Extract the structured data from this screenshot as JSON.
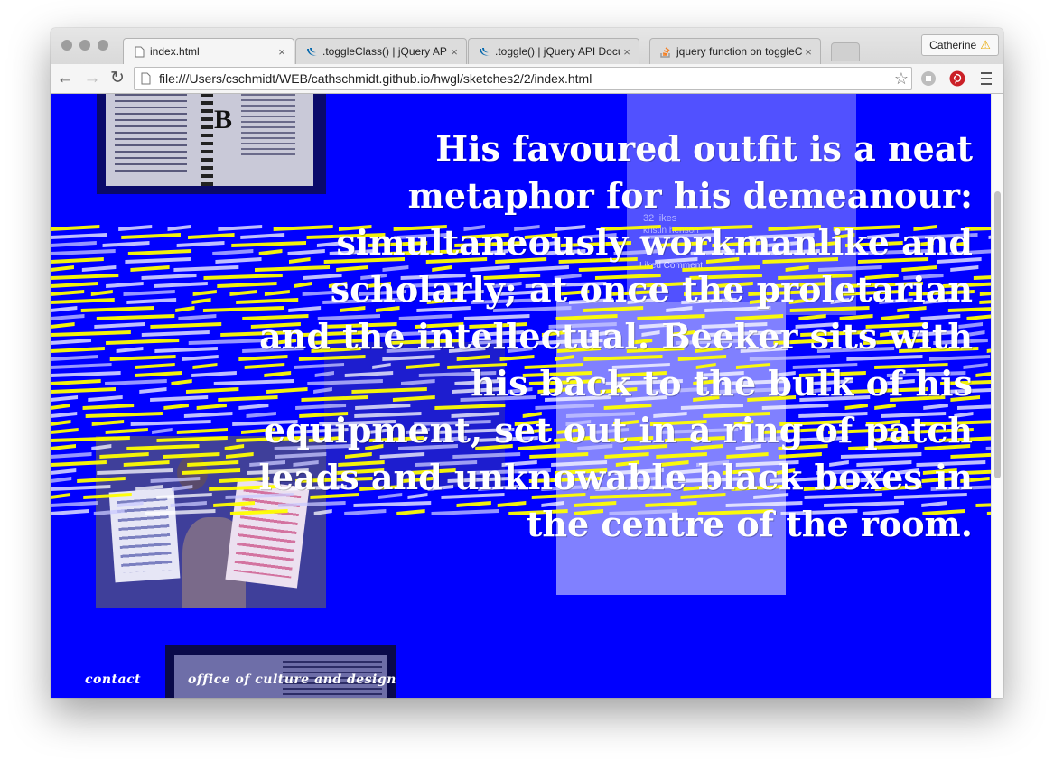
{
  "browser": {
    "tabs": [
      {
        "title": "index.html",
        "active": true,
        "icon": "page-icon"
      },
      {
        "title": ".toggleClass() | jQuery API",
        "active": false,
        "icon": "jquery-icon"
      },
      {
        "title": ".toggle() | jQuery API Docu",
        "active": false,
        "icon": "jquery-icon"
      },
      {
        "title": "jquery function on toggleC",
        "active": false,
        "icon": "stackoverflow-icon"
      }
    ],
    "close_glyph": "×",
    "profile_name": "Catherine",
    "profile_warning": "⚠",
    "url": "file:///Users/cschmidt/WEB/cathschmidt.github.io/hwgl/sketches2/2/index.html",
    "star": "☆",
    "nav": {
      "back": "←",
      "forward": "→",
      "reload": "↻"
    },
    "colors": {
      "pinterest": "#cb2027",
      "page_bg": "#0000ff",
      "stripe_yellow": "#ffff00"
    }
  },
  "page": {
    "quote": "His favoured outfit is a neat metaphor for his demeanour: simultaneously workmanlike and scholarly; at once the proletarian and the intellectual. Beeker sits with his back to the bulk of his equipment, set out in a ring of patch leads and unknowable black boxes in the centre of the room.",
    "links": {
      "contact": "contact",
      "office": "office of culture and design"
    },
    "photo_social": {
      "likes": "32 likes",
      "names": "kristin henson",
      "actions": "Liked   Comment"
    },
    "book_letter": "B"
  }
}
